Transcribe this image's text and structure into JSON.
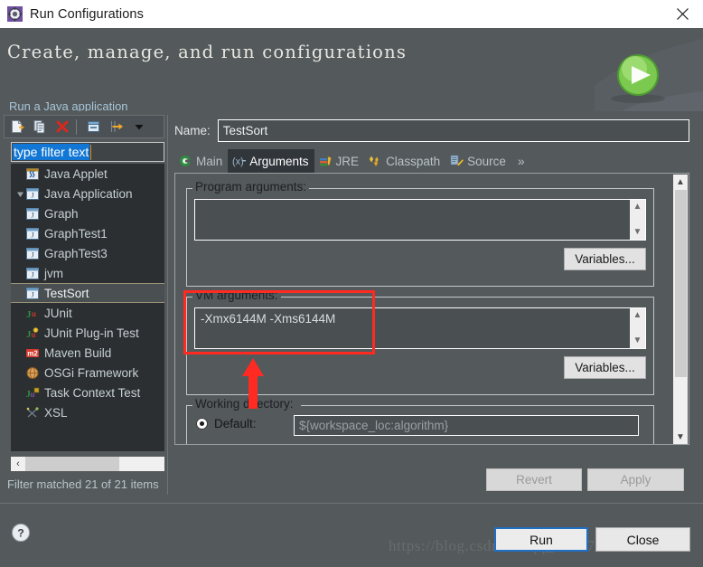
{
  "window": {
    "title": "Run Configurations",
    "icon": "run-configurations-icon",
    "close_label": "✕"
  },
  "banner": {
    "heading": "Create, manage, and run configurations",
    "subheading": "Run a Java application",
    "icon": "green-run-play-icon"
  },
  "left_panel": {
    "toolbar": [
      {
        "name": "new-launch-configuration-icon",
        "tooltip": "New launch configuration"
      },
      {
        "name": "duplicate-icon",
        "tooltip": "Duplicate"
      },
      {
        "name": "delete-icon",
        "tooltip": "Delete"
      },
      {
        "name": "collapse-all-icon",
        "tooltip": "Collapse All"
      },
      {
        "name": "filter-launch-configurations-icon",
        "tooltip": "Filter launch configurations"
      },
      {
        "name": "view-menu-chevron-icon",
        "tooltip": "View Menu"
      }
    ],
    "filter": {
      "value": "type filter text",
      "placeholder": "type filter text"
    },
    "tree": [
      {
        "label": "Java Applet",
        "level": 0,
        "icon": "java-applet-icon",
        "expandable": false,
        "selected": false
      },
      {
        "label": "Java Application",
        "level": 0,
        "icon": "java-application-icon",
        "expandable": true,
        "expanded": true,
        "selected": false
      },
      {
        "label": "Graph",
        "level": 1,
        "icon": "java-application-icon",
        "expandable": false,
        "selected": false
      },
      {
        "label": "GraphTest1",
        "level": 1,
        "icon": "java-application-icon",
        "expandable": false,
        "selected": false
      },
      {
        "label": "GraphTest3",
        "level": 1,
        "icon": "java-application-icon",
        "expandable": false,
        "selected": false
      },
      {
        "label": "jvm",
        "level": 1,
        "icon": "java-application-icon",
        "expandable": false,
        "selected": false
      },
      {
        "label": "TestSort",
        "level": 1,
        "icon": "java-application-icon",
        "expandable": false,
        "selected": true
      },
      {
        "label": "JUnit",
        "level": 0,
        "icon": "junit-icon",
        "expandable": false,
        "selected": false
      },
      {
        "label": "JUnit Plug-in Test",
        "level": 0,
        "icon": "junit-plugin-icon",
        "expandable": false,
        "selected": false
      },
      {
        "label": "Maven Build",
        "level": 0,
        "icon": "maven-icon",
        "expandable": false,
        "selected": false
      },
      {
        "label": "OSGi Framework",
        "level": 0,
        "icon": "osgi-icon",
        "expandable": false,
        "selected": false
      },
      {
        "label": "Task Context Test",
        "level": 0,
        "icon": "task-context-test-icon",
        "expandable": false,
        "selected": false
      },
      {
        "label": "XSL",
        "level": 0,
        "icon": "xsl-icon",
        "expandable": false,
        "selected": false
      }
    ],
    "status": "Filter matched 21 of 21 items",
    "hscrollbar_left_arrow": "‹"
  },
  "right_panel": {
    "name_label": "Name:",
    "name_value": "TestSort",
    "tabs": [
      {
        "label": "Main",
        "icon": "main-tab-icon",
        "active": false
      },
      {
        "label": "Arguments",
        "icon": "arguments-tab-icon",
        "active": true
      },
      {
        "label": "JRE",
        "icon": "jre-tab-icon",
        "active": false
      },
      {
        "label": "Classpath",
        "icon": "classpath-tab-icon",
        "active": false
      },
      {
        "label": "Source",
        "icon": "source-tab-icon",
        "active": false
      }
    ],
    "tabs_overflow": "»",
    "program_arguments": {
      "group_title": "Program arguments:",
      "value": "",
      "variables_button": "Variables..."
    },
    "vm_arguments": {
      "group_title": "VM arguments:",
      "value": "-Xmx6144M -Xms6144M",
      "variables_button": "Variables..."
    },
    "working_directory": {
      "group_title": "Working directory:",
      "default_label": "Default:",
      "default_checked": true,
      "path_value": "${workspace_loc:algorithm}"
    },
    "revert_button": "Revert",
    "apply_button": "Apply"
  },
  "footer": {
    "help_icon": "help-question-icon",
    "run_button": "Run",
    "close_button": "Close",
    "watermark": "https://blog.csdn.net/qq_27717967"
  },
  "annotations": {
    "highlight_box": "red-rectangle-vm-arguments",
    "pointer": "red-arrow-up"
  },
  "colors": {
    "dialog_bg": "#54595c",
    "tree_bg": "#2b2f31",
    "accent_blue": "#1277d4",
    "annotation_red": "#ff2a21",
    "link_text": "#a8c6d8"
  }
}
